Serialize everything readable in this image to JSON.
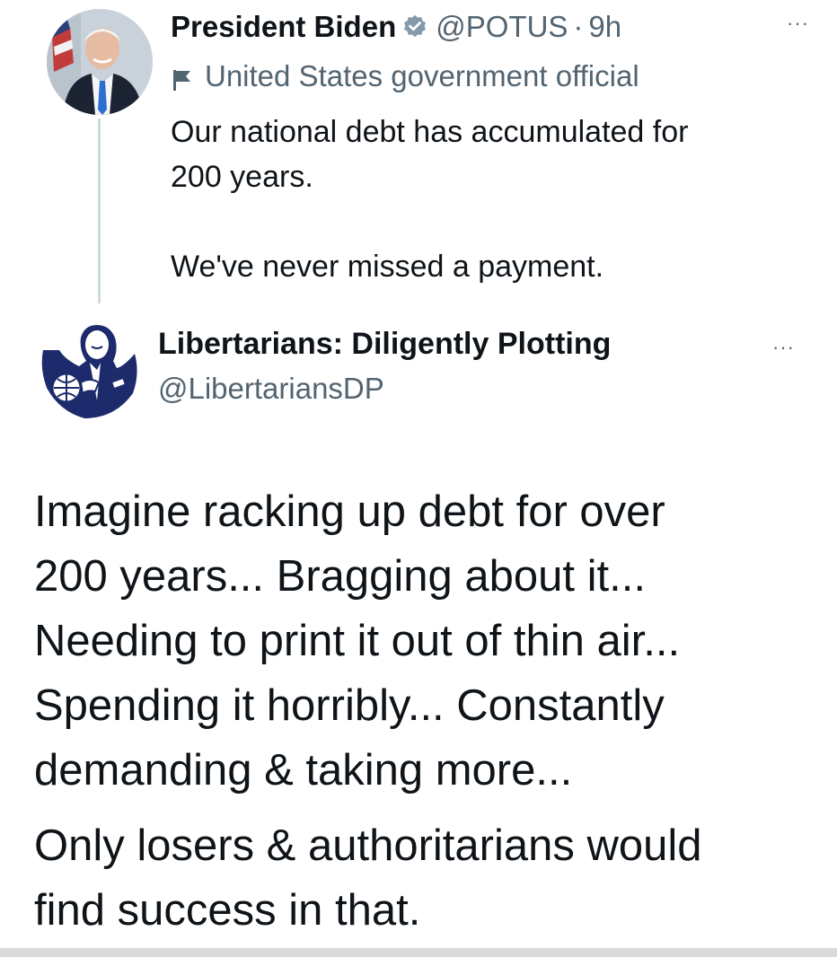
{
  "tweet_original": {
    "author_name": "President Biden",
    "handle": "@POTUS",
    "separator": "·",
    "time": "9h",
    "label": "United States government official",
    "body": "Our national debt has accumulated for\n200 years.\n\nWe've never missed a payment."
  },
  "tweet_reply": {
    "author_name": "Libertarians: Diligently Plotting",
    "handle": "@LibertariansDP",
    "paragraph_1": "Imagine racking up debt for over\n200 years... Bragging about it...\nNeeding to print it out of thin air...\nSpending it horribly... Constantly\ndemanding & taking more...",
    "paragraph_2": "Only losers & authoritarians would\nfind success in that."
  },
  "menu_glyph": "···",
  "colors": {
    "text_primary": "#0f1419",
    "text_secondary": "#536471",
    "verified_badge": "#829aab",
    "thread_line": "#cfd9de",
    "avatar_ink": "#1d2a6b"
  },
  "icons": {
    "verified": "verified-badge-icon",
    "gov_label": "flag-icon",
    "menu": "more-options-icon"
  }
}
